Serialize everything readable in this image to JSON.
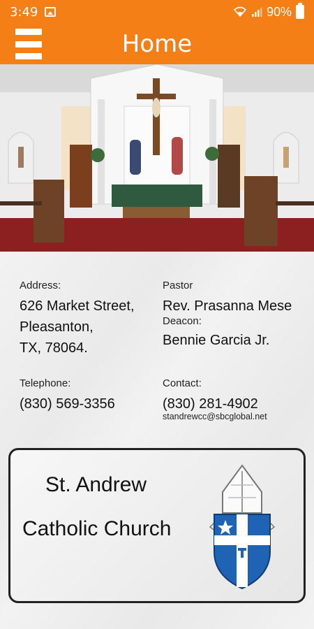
{
  "status_bar": {
    "time": "3:49",
    "battery": "90%"
  },
  "app_bar": {
    "title": "Home"
  },
  "info": {
    "address_label": "Address:",
    "address_line1": "626 Market Street,",
    "address_line2": "Pleasanton,",
    "address_line3": "TX, 78064.",
    "pastor_label": "Pastor",
    "pastor_name": "Rev. Prasanna Mese",
    "deacon_label": "Deacon:",
    "deacon_name": "Bennie Garcia Jr.",
    "telephone_label": "Telephone:",
    "telephone_number": "(830) 569-3356",
    "contact_label": "Contact:",
    "contact_number": "(830) 281-4902",
    "contact_email": "standrewcc@sbcglobal.net"
  },
  "card": {
    "line1": "St. Andrew",
    "line2": "Catholic Church"
  },
  "colors": {
    "accent": "#f57f17",
    "crest_blue": "#1f64b4"
  },
  "icons": [
    "menu-icon",
    "image-icon",
    "wifi-icon",
    "signal-icon",
    "battery-icon",
    "church-crest-icon"
  ]
}
